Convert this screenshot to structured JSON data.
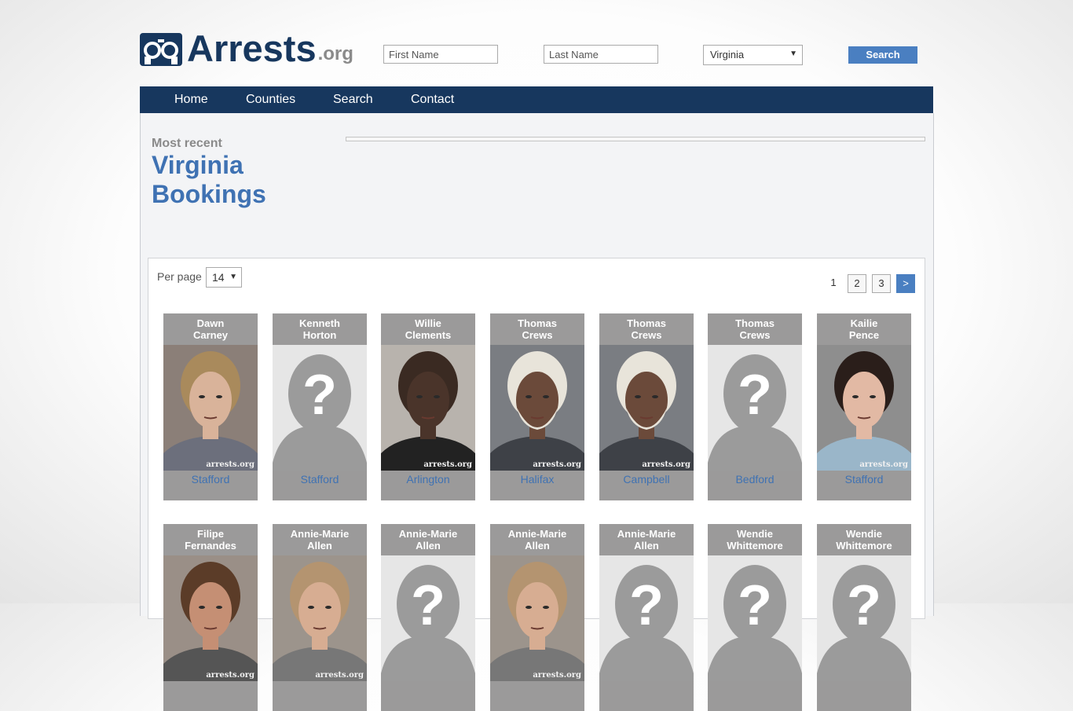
{
  "header": {
    "logo_text": "Arrests",
    "logo_suffix": ".org",
    "first_name_placeholder": "First Name",
    "last_name_placeholder": "Last Name",
    "state_selected": "Virginia",
    "search_label": "Search"
  },
  "nav": {
    "items": [
      {
        "label": "Home"
      },
      {
        "label": "Counties"
      },
      {
        "label": "Search"
      },
      {
        "label": "Contact"
      }
    ]
  },
  "main": {
    "subtitle": "Most recent",
    "title_line1": "Virginia",
    "title_line2": "Bookings"
  },
  "listing": {
    "per_page_label": "Per page",
    "per_page_value": "14",
    "pages": [
      "1",
      "2",
      "3"
    ],
    "next_label": ">",
    "watermark": "arrests.org",
    "cards": [
      {
        "first": "Dawn",
        "last": "Carney",
        "county": "Stafford",
        "photo": "woman-blonde"
      },
      {
        "first": "Kenneth",
        "last": "Horton",
        "county": "Stafford",
        "photo": "placeholder"
      },
      {
        "first": "Willie",
        "last": "Clements",
        "county": "Arlington",
        "photo": "man-bald"
      },
      {
        "first": "Thomas",
        "last": "Crews",
        "county": "Halifax",
        "photo": "man-grey-beard"
      },
      {
        "first": "Thomas",
        "last": "Crews",
        "county": "Campbell",
        "photo": "man-grey-beard"
      },
      {
        "first": "Thomas",
        "last": "Crews",
        "county": "Bedford",
        "photo": "placeholder"
      },
      {
        "first": "Kailie",
        "last": "Pence",
        "county": "Stafford",
        "photo": "woman-dark-hair"
      },
      {
        "first": "Filipe",
        "last": "Fernandes",
        "county": "",
        "photo": "man-brown-hair"
      },
      {
        "first": "Annie-Marie",
        "last": "Allen",
        "county": "",
        "photo": "woman-light-hair"
      },
      {
        "first": "Annie-Marie",
        "last": "Allen",
        "county": "",
        "photo": "placeholder"
      },
      {
        "first": "Annie-Marie",
        "last": "Allen",
        "county": "",
        "photo": "woman-light-hair"
      },
      {
        "first": "Annie-Marie",
        "last": "Allen",
        "county": "",
        "photo": "placeholder"
      },
      {
        "first": "Wendie",
        "last": "Whittemore",
        "county": "",
        "photo": "placeholder"
      },
      {
        "first": "Wendie",
        "last": "Whittemore",
        "county": "",
        "photo": "placeholder"
      }
    ]
  },
  "colors": {
    "brand_navy": "#17375e",
    "accent_blue": "#4a7fc1",
    "link_blue": "#3f72b3",
    "card_grey": "#9b9a9a"
  }
}
